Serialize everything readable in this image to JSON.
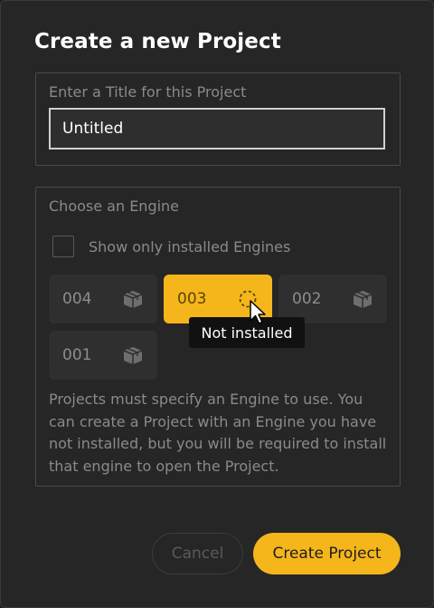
{
  "dialog": {
    "title": "Create a new Project",
    "title_section": {
      "legend": "Enter a Title for this Project",
      "input_value": "Untitled"
    },
    "engine_section": {
      "legend": "Choose an Engine",
      "checkbox_label": "Show only installed Engines",
      "checkbox_checked": false,
      "engines": [
        {
          "label": "004",
          "icon": "package-icon",
          "selected": false
        },
        {
          "label": "003",
          "icon": "dashed-circle-icon",
          "selected": true
        },
        {
          "label": "002",
          "icon": "package-icon",
          "selected": false
        },
        {
          "label": "001",
          "icon": "package-icon",
          "selected": false
        }
      ],
      "tooltip": "Not installed",
      "description": "Projects must specify an Engine to use. You can create a Project with an Engine you have not installed, but you will be required to install that engine to open the Project."
    },
    "buttons": {
      "cancel": "Cancel",
      "create": "Create Project"
    }
  },
  "colors": {
    "accent": "#f5b61c",
    "background": "#262626",
    "muted_text": "#8a8a8a"
  }
}
